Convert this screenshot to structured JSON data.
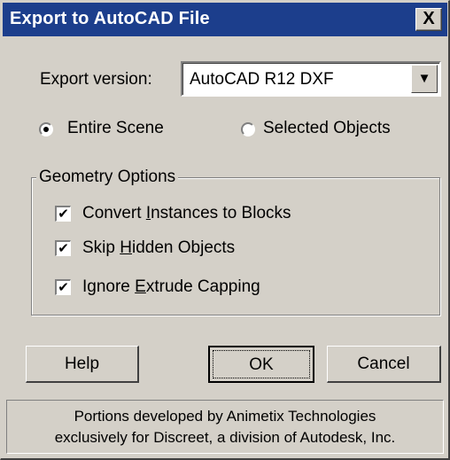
{
  "window": {
    "title": "Export to AutoCAD File",
    "close_label": "X"
  },
  "export_version": {
    "label": "Export version:",
    "value": "AutoCAD R12 DXF",
    "arrow": "▼"
  },
  "radios": [
    {
      "label": "Entire Scene",
      "selected": true
    },
    {
      "label": "Selected Objects",
      "selected": false
    }
  ],
  "geometry": {
    "title": "Geometry Options",
    "checkboxes": [
      {
        "pre": "Convert ",
        "mnemonic": "I",
        "post": "nstances to Blocks",
        "checked": true
      },
      {
        "pre": "Skip ",
        "mnemonic": "H",
        "post": "idden Objects",
        "checked": true
      },
      {
        "pre": "Ignore ",
        "mnemonic": "E",
        "post": "xtrude Capping",
        "checked": true
      }
    ]
  },
  "buttons": {
    "help": "Help",
    "ok": "OK",
    "cancel": "Cancel"
  },
  "footer": {
    "line1": "Portions developed by Animetix Technologies",
    "line2": "exclusively for Discreet, a division of Autodesk, Inc."
  },
  "check_glyph": "✔"
}
